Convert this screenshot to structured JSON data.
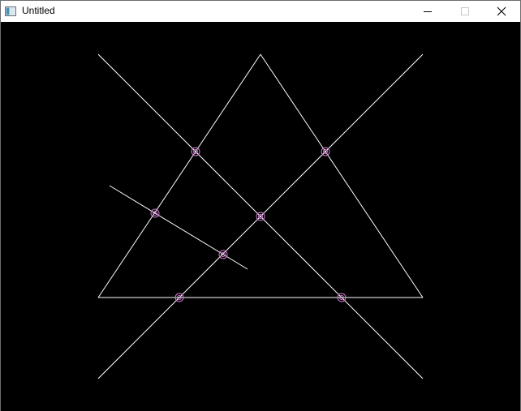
{
  "window": {
    "title": "Untitled",
    "icon": "app-window-icon",
    "controls": [
      "minimize-icon",
      "maximize-icon",
      "close-icon"
    ]
  },
  "canvas": {
    "background": "#000000",
    "line_color": "#ffffff",
    "marker_color": "#d07ad0"
  }
}
